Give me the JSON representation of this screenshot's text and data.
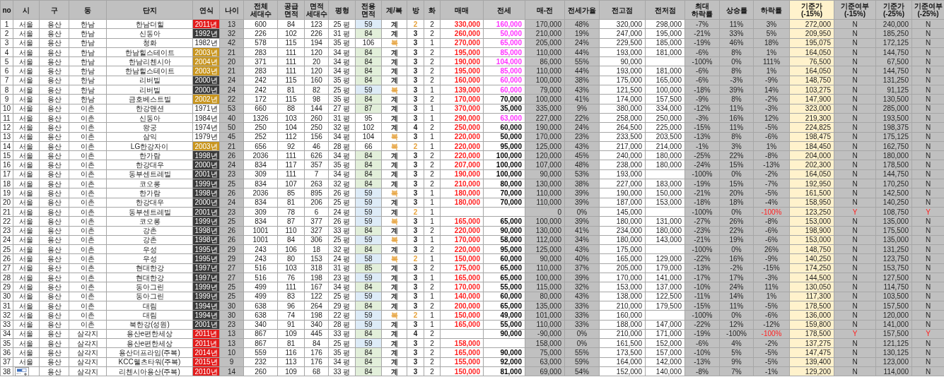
{
  "sheet": {
    "columns": [
      "no",
      "시",
      "구",
      "동",
      "단지",
      "연식",
      "나이",
      "전체 세대수",
      "공급 면적",
      "면적 세대수",
      "평형",
      "전용 면적",
      "계/복",
      "방",
      "화",
      "매매",
      "전세",
      "매-전",
      "전세가율",
      "전고점",
      "전저점",
      "최대 하락률",
      "상승률",
      "하락률",
      "기준가 (-15%)",
      "기준여부 (-15%)",
      "기준가 (-25%)",
      "기준여부 (-25%)"
    ],
    "rows": [
      {
        "cells": [
          "1",
          "서울",
          "용산",
          "한남",
          "한남더힐",
          {
            "text": "2011년",
            "color": "#e31b1b"
          },
          "13",
          "600",
          "84",
          "123",
          "25 평",
          {
            "text": "59",
            "color": "#ddebf7"
          },
          "계",
          {
            "text": "2",
            "color": "#e6a23c"
          },
          "2",
          "330,000",
          {
            "text": "160,000",
            "color": "#ff33ff"
          },
          "170,000",
          "48%",
          "320,000",
          "298,000",
          "-7%",
          "11%",
          "3%",
          "272,000",
          "N",
          "240,000",
          "N"
        ],
        "alert": false
      },
      {
        "cells": [
          "2",
          "서울",
          "용산",
          "한남",
          "신동아",
          {
            "text": "1992년",
            "color": "#3b3b3b"
          },
          "32",
          "226",
          "102",
          "226",
          "31 평",
          {
            "text": "84",
            "color": "#e2efda"
          },
          "계",
          "3",
          "2",
          "260,000",
          {
            "text": "50,000",
            "color": "#ff33ff"
          },
          "210,000",
          "19%",
          "247,000",
          "195,000",
          "-21%",
          "33%",
          "5%",
          "209,950",
          "N",
          "185,250",
          "N"
        ],
        "alert": false
      },
      {
        "cells": [
          "3",
          "서울",
          "용산",
          "한남",
          "청화",
          {
            "text": "1982년",
            "color": "#ffffff"
          },
          "42",
          "578",
          "115",
          "194",
          "35 평",
          {
            "text": "106",
            "color": "#ffffff"
          },
          {
            "text": "복",
            "color": "#e6a23c"
          },
          "3",
          "1",
          "270,000",
          {
            "text": "65,000",
            "color": "#ff33ff"
          },
          "205,000",
          "24%",
          "229,500",
          "185,000",
          "-19%",
          "46%",
          "18%",
          "195,075",
          "N",
          "172,125",
          "N"
        ],
        "alert": false
      },
      {
        "cells": [
          "4",
          "서울",
          "용산",
          "한남",
          "한남힐스테이트",
          {
            "text": "2003년",
            "color": "#c9961f"
          },
          "21",
          "283",
          "111",
          "120",
          "34 평",
          {
            "text": "84",
            "color": "#e2efda"
          },
          "계",
          "3",
          "2",
          "195,000",
          {
            "text": "85,000",
            "color": "#ff33ff"
          },
          "110,000",
          "44%",
          "193,000",
          "181,000",
          "-6%",
          "8%",
          "1%",
          "164,050",
          "N",
          "144,750",
          "N"
        ],
        "alert": false
      },
      {
        "cells": [
          "5",
          "서울",
          "용산",
          "한남",
          "한남리첸시아",
          {
            "text": "2004년",
            "color": "#c9961f"
          },
          "20",
          "371",
          "111",
          "20",
          "34 평",
          {
            "text": "84",
            "color": "#e2efda"
          },
          "계",
          "3",
          "2",
          "190,000",
          {
            "text": "104,000",
            "color": "#ff33ff"
          },
          "86,000",
          "55%",
          "90,000",
          null,
          "-100%",
          "0%",
          "111%",
          "76,500",
          "N",
          "67,500",
          "N"
        ],
        "alert": false
      },
      {
        "cells": [
          "6",
          "서울",
          "용산",
          "한남",
          "한남힐스테이트",
          {
            "text": "2003년",
            "color": "#c9961f"
          },
          "21",
          "283",
          "111",
          "120",
          "34 평",
          {
            "text": "84",
            "color": "#e2efda"
          },
          "계",
          "3",
          "2",
          "195,000",
          {
            "text": "85,000",
            "color": "#ff33ff"
          },
          "110,000",
          "44%",
          "193,000",
          "181,000",
          "-6%",
          "8%",
          "1%",
          "164,050",
          "N",
          "144,750",
          "N"
        ],
        "alert": false
      },
      {
        "cells": [
          "7",
          "서울",
          "용산",
          "한남",
          "리버빌",
          {
            "text": "2000년",
            "color": "#3b3b3b"
          },
          "24",
          "242",
          "115",
          "160",
          "35 평",
          {
            "text": "84",
            "color": "#e2efda"
          },
          "계",
          "3",
          "2",
          "160,000",
          {
            "text": "60,000",
            "color": "#ff33ff"
          },
          "100,000",
          "38%",
          "175,000",
          "165,000",
          "-6%",
          "-3%",
          "-9%",
          "148,750",
          "N",
          "131,250",
          "N"
        ],
        "alert": false
      },
      {
        "cells": [
          "8",
          "서울",
          "용산",
          "한남",
          "리버빌",
          {
            "text": "2000년",
            "color": "#3b3b3b"
          },
          "24",
          "242",
          "81",
          "82",
          "25 평",
          {
            "text": "59",
            "color": "#ddebf7"
          },
          {
            "text": "복",
            "color": "#e6a23c"
          },
          "3",
          "1",
          "139,000",
          {
            "text": "60,000",
            "color": "#ff33ff"
          },
          "79,000",
          "43%",
          "121,500",
          "100,000",
          "-18%",
          "39%",
          "14%",
          "103,275",
          "N",
          "91,125",
          "N"
        ],
        "alert": false
      },
      {
        "cells": [
          "9",
          "서울",
          "용산",
          "한남",
          "금호베스트빌",
          {
            "text": "2002년",
            "color": "#c9961f"
          },
          "22",
          "172",
          "115",
          "98",
          "35 평",
          {
            "text": "84",
            "color": "#e2efda"
          },
          "계",
          "3",
          "2",
          "170,000",
          {
            "text": "70,000",
            "color": "#000000"
          },
          "100,000",
          "41%",
          "174,000",
          "157,500",
          "-9%",
          "8%",
          "-2%",
          "147,900",
          "N",
          "130,500",
          "N"
        ],
        "alert": false
      },
      {
        "cells": [
          "10",
          "서울",
          "용산",
          "이촌",
          "한강맨션",
          {
            "text": "1971년",
            "color": "#ffffff"
          },
          "53",
          "660",
          "88",
          "144",
          "27 평",
          {
            "text": "87",
            "color": "#e2efda"
          },
          "계",
          "3",
          "1",
          "370,000",
          {
            "text": "35,000",
            "color": "#000000"
          },
          "335,000",
          "9%",
          "380,000",
          "334,000",
          "-12%",
          "11%",
          "-3%",
          "323,000",
          "N",
          "285,000",
          "N"
        ],
        "alert": false
      },
      {
        "cells": [
          "11",
          "서울",
          "용산",
          "이촌",
          "신동아",
          {
            "text": "1984년",
            "color": "#ffffff"
          },
          "40",
          "1326",
          "103",
          "260",
          "31 평",
          {
            "text": "95",
            "color": "#ffffff"
          },
          "계",
          "3",
          "1",
          "290,000",
          {
            "text": "63,000",
            "color": "#ff33ff"
          },
          "227,000",
          "22%",
          "258,000",
          "250,000",
          "-3%",
          "16%",
          "12%",
          "219,300",
          "N",
          "193,500",
          "N"
        ],
        "alert": false
      },
      {
        "cells": [
          "12",
          "서울",
          "용산",
          "이촌",
          "왕궁",
          {
            "text": "1974년",
            "color": "#ffffff"
          },
          "50",
          "250",
          "104",
          "250",
          "32 평",
          {
            "text": "102",
            "color": "#ffffff"
          },
          "계",
          "4",
          "2",
          "250,000",
          {
            "text": "60,000",
            "color": "#000000"
          },
          "190,000",
          "24%",
          "264,500",
          "225,000",
          "-15%",
          "11%",
          "-5%",
          "224,825",
          "N",
          "198,375",
          "N"
        ],
        "alert": false
      },
      {
        "cells": [
          "13",
          "서울",
          "용산",
          "이촌",
          "삼익",
          {
            "text": "1979년",
            "color": "#ffffff"
          },
          "45",
          "252",
          "112",
          "156",
          "34 평",
          {
            "text": "104",
            "color": "#ffffff"
          },
          {
            "text": "복",
            "color": "#e6a23c"
          },
          "3",
          "1",
          "220,000",
          {
            "text": "50,000",
            "color": "#000000"
          },
          "170,000",
          "23%",
          "233,500",
          "203,500",
          "-13%",
          "8%",
          "-6%",
          "198,475",
          "N",
          "175,125",
          "N"
        ],
        "alert": false
      },
      {
        "cells": [
          "14",
          "서울",
          "용산",
          "이촌",
          "LG한강자이",
          {
            "text": "2003년",
            "color": "#c9961f"
          },
          "21",
          "656",
          "92",
          "46",
          "28 평",
          {
            "text": "66",
            "color": "#ffffff"
          },
          {
            "text": "복",
            "color": "#e6a23c"
          },
          {
            "text": "2",
            "color": "#e6a23c"
          },
          "1",
          "220,000",
          {
            "text": "95,000",
            "color": "#000000"
          },
          "125,000",
          "43%",
          "217,000",
          "214,000",
          "-1%",
          "3%",
          "1%",
          "184,450",
          "N",
          "162,750",
          "N"
        ],
        "alert": false
      },
      {
        "cells": [
          "15",
          "서울",
          "용산",
          "이촌",
          "한가람",
          {
            "text": "1998년",
            "color": "#3b3b3b"
          },
          "26",
          "2036",
          "111",
          "626",
          "34 평",
          {
            "text": "84",
            "color": "#e2efda"
          },
          "계",
          "3",
          "2",
          "220,000",
          {
            "text": "100,000",
            "color": "#000000"
          },
          "120,000",
          "45%",
          "240,000",
          "180,000",
          "-25%",
          "22%",
          "-8%",
          "204,000",
          "N",
          "180,000",
          "N"
        ],
        "alert": false
      },
      {
        "cells": [
          "16",
          "서울",
          "용산",
          "이촌",
          "한강대우",
          {
            "text": "2000년",
            "color": "#3b3b3b"
          },
          "24",
          "834",
          "117",
          "357",
          "35 평",
          {
            "text": "84",
            "color": "#e2efda"
          },
          "계",
          "3",
          "2",
          "207,000",
          {
            "text": "100,000",
            "color": "#000000"
          },
          "107,000",
          "48%",
          "238,000",
          "180,000",
          "-24%",
          "15%",
          "-13%",
          "202,300",
          "N",
          "178,500",
          "N"
        ],
        "alert": false
      },
      {
        "cells": [
          "17",
          "서울",
          "용산",
          "이촌",
          "동부센트레빌",
          {
            "text": "2001년",
            "color": "#3b3b3b"
          },
          "23",
          "309",
          "111",
          "7",
          "34 평",
          {
            "text": "84",
            "color": "#e2efda"
          },
          "계",
          "3",
          "2",
          "190,000",
          {
            "text": "100,000",
            "color": "#000000"
          },
          "90,000",
          "53%",
          "193,000",
          null,
          "-100%",
          "0%",
          "-2%",
          "164,050",
          "N",
          "144,750",
          "N"
        ],
        "alert": false
      },
      {
        "cells": [
          "18",
          "서울",
          "용산",
          "이촌",
          "코오롱",
          {
            "text": "1999년",
            "color": "#3b3b3b"
          },
          "25",
          "834",
          "107",
          "263",
          "32 평",
          {
            "text": "84",
            "color": "#e2efda"
          },
          "계",
          "3",
          "2",
          "210,000",
          {
            "text": "80,000",
            "color": "#000000"
          },
          "130,000",
          "38%",
          "227,000",
          "183,000",
          "-19%",
          "15%",
          "-7%",
          "192,950",
          "N",
          "170,250",
          "N"
        ],
        "alert": false
      },
      {
        "cells": [
          "19",
          "서울",
          "용산",
          "이촌",
          "한가람",
          {
            "text": "1998년",
            "color": "#3b3b3b"
          },
          "26",
          "2036",
          "85",
          "895",
          "26 평",
          {
            "text": "59",
            "color": "#ddebf7"
          },
          {
            "text": "복",
            "color": "#e6a23c"
          },
          "3",
          "1",
          "180,000",
          {
            "text": "70,000",
            "color": "#000000"
          },
          "110,000",
          "39%",
          "190,000",
          "150,000",
          "-21%",
          "20%",
          "-5%",
          "161,500",
          "N",
          "142,500",
          "N"
        ],
        "alert": false
      },
      {
        "cells": [
          "20",
          "서울",
          "용산",
          "이촌",
          "한강대우",
          {
            "text": "2000년",
            "color": "#3b3b3b"
          },
          "24",
          "834",
          "81",
          "206",
          "25 평",
          {
            "text": "59",
            "color": "#ddebf7"
          },
          "계",
          "3",
          "1",
          "180,000",
          {
            "text": "70,000",
            "color": "#000000"
          },
          "110,000",
          "39%",
          "187,000",
          "153,000",
          "-18%",
          "18%",
          "-4%",
          "158,950",
          "N",
          "140,250",
          "N"
        ],
        "alert": false
      },
      {
        "cells": [
          "21",
          "서울",
          "용산",
          "이촌",
          "동부센트레빌",
          {
            "text": "2001년",
            "color": "#3b3b3b"
          },
          "23",
          "309",
          "78",
          "6",
          "24 평",
          {
            "text": "59",
            "color": "#ddebf7"
          },
          "계",
          {
            "text": "2",
            "color": "#e6a23c"
          },
          "1",
          null,
          null,
          "0",
          "0%",
          "145,000",
          null,
          "-100%",
          "0%",
          "-100%",
          "123,250",
          "Y",
          "108,750",
          "Y"
        ],
        "alert": true
      },
      {
        "cells": [
          "22",
          "서울",
          "용산",
          "이촌",
          "코오롱",
          {
            "text": "1999년",
            "color": "#3b3b3b"
          },
          "25",
          "834",
          "87",
          "377",
          "26 평",
          {
            "text": "59",
            "color": "#ddebf7"
          },
          {
            "text": "복",
            "color": "#e6a23c"
          },
          "3",
          "1",
          "165,000",
          {
            "text": "65,000",
            "color": "#000000"
          },
          "100,000",
          "39%",
          "180,000",
          "131,000",
          "-27%",
          "26%",
          "-8%",
          "153,000",
          "N",
          "135,000",
          "N"
        ],
        "alert": false
      },
      {
        "cells": [
          "23",
          "서울",
          "용산",
          "이촌",
          "강촌",
          {
            "text": "1998년",
            "color": "#3b3b3b"
          },
          "26",
          "1001",
          "110",
          "327",
          "33 평",
          {
            "text": "84",
            "color": "#e2efda"
          },
          "계",
          "3",
          "2",
          "220,000",
          {
            "text": "90,000",
            "color": "#000000"
          },
          "130,000",
          "41%",
          "234,000",
          "180,000",
          "-23%",
          "22%",
          "-6%",
          "198,900",
          "N",
          "175,500",
          "N"
        ],
        "alert": false
      },
      {
        "cells": [
          "24",
          "서울",
          "용산",
          "이촌",
          "강촌",
          {
            "text": "1998년",
            "color": "#3b3b3b"
          },
          "26",
          "1001",
          "84",
          "306",
          "25 평",
          {
            "text": "59",
            "color": "#ddebf7"
          },
          {
            "text": "복",
            "color": "#e6a23c"
          },
          "3",
          "1",
          "170,000",
          {
            "text": "58,000",
            "color": "#000000"
          },
          "112,000",
          "34%",
          "180,000",
          "143,000",
          "-21%",
          "19%",
          "-6%",
          "153,000",
          "N",
          "135,000",
          "N"
        ],
        "alert": false
      },
      {
        "cells": [
          "25",
          "서울",
          "용산",
          "이촌",
          "우성",
          {
            "text": "1995년",
            "color": "#3b3b3b"
          },
          "29",
          "243",
          "106",
          "18",
          "32 평",
          {
            "text": "84",
            "color": "#e2efda"
          },
          "계",
          "3",
          "2",
          "220,000",
          {
            "text": "95,000",
            "color": "#000000"
          },
          "125,000",
          "43%",
          "175,000",
          null,
          "-100%",
          "0%",
          "26%",
          "148,750",
          "N",
          "131,250",
          "N"
        ],
        "alert": false
      },
      {
        "cells": [
          "26",
          "서울",
          "용산",
          "이촌",
          "우성",
          {
            "text": "1995년",
            "color": "#3b3b3b"
          },
          "29",
          "243",
          "80",
          "153",
          "24 평",
          {
            "text": "58",
            "color": "#ddebf7"
          },
          {
            "text": "복",
            "color": "#e6a23c"
          },
          {
            "text": "2",
            "color": "#e6a23c"
          },
          "1",
          "150,000",
          {
            "text": "60,000",
            "color": "#000000"
          },
          "90,000",
          "40%",
          "165,000",
          "129,000",
          "-22%",
          "16%",
          "-9%",
          "140,250",
          "N",
          "123,750",
          "N"
        ],
        "alert": false
      },
      {
        "cells": [
          "27",
          "서울",
          "용산",
          "이촌",
          "현대한강",
          {
            "text": "1997년",
            "color": "#3b3b3b"
          },
          "27",
          "516",
          "103",
          "318",
          "31 평",
          {
            "text": "85",
            "color": "#e2efda"
          },
          "계",
          "3",
          "2",
          "175,000",
          {
            "text": "65,000",
            "color": "#000000"
          },
          "110,000",
          "37%",
          "205,000",
          "179,000",
          "-13%",
          "-2%",
          "-15%",
          "174,250",
          "N",
          "153,750",
          "N"
        ],
        "alert": false
      },
      {
        "cells": [
          "28",
          "서울",
          "용산",
          "이촌",
          "현대한강",
          {
            "text": "1997년",
            "color": "#3b3b3b"
          },
          "27",
          "516",
          "76",
          "198",
          "23 평",
          {
            "text": "59",
            "color": "#ddebf7"
          },
          "계",
          "3",
          "1",
          "165,000",
          {
            "text": "65,000",
            "color": "#000000"
          },
          "100,000",
          "39%",
          "170,000",
          "141,000",
          "-17%",
          "17%",
          "-3%",
          "144,500",
          "N",
          "127,500",
          "N"
        ],
        "alert": false
      },
      {
        "cells": [
          "29",
          "서울",
          "용산",
          "이촌",
          "동아그린",
          {
            "text": "1999년",
            "color": "#3b3b3b"
          },
          "25",
          "499",
          "111",
          "167",
          "34 평",
          {
            "text": "84",
            "color": "#e2efda"
          },
          "계",
          "3",
          "2",
          "170,000",
          {
            "text": "55,000",
            "color": "#000000"
          },
          "115,000",
          "32%",
          "153,000",
          "137,000",
          "-10%",
          "24%",
          "11%",
          "130,050",
          "N",
          "114,750",
          "N"
        ],
        "alert": false
      },
      {
        "cells": [
          "30",
          "서울",
          "용산",
          "이촌",
          "동아그린",
          {
            "text": "1999년",
            "color": "#3b3b3b"
          },
          "25",
          "499",
          "83",
          "122",
          "25 평",
          {
            "text": "59",
            "color": "#ddebf7"
          },
          "계",
          "3",
          "1",
          "140,000",
          {
            "text": "60,000",
            "color": "#000000"
          },
          "80,000",
          "43%",
          "138,000",
          "122,500",
          "-11%",
          "14%",
          "1%",
          "117,300",
          "N",
          "103,500",
          "N"
        ],
        "alert": false
      },
      {
        "cells": [
          "31",
          "서울",
          "용산",
          "이촌",
          "대림",
          {
            "text": "1994년",
            "color": "#3b3b3b"
          },
          "30",
          "638",
          "96",
          "264",
          "29 평",
          {
            "text": "84",
            "color": "#e2efda"
          },
          "계",
          "3",
          "2",
          "200,000",
          {
            "text": "65,000",
            "color": "#000000"
          },
          "135,000",
          "33%",
          "210,000",
          "179,500",
          "-15%",
          "11%",
          "-5%",
          "178,500",
          "N",
          "157,500",
          "N"
        ],
        "alert": false
      },
      {
        "cells": [
          "32",
          "서울",
          "용산",
          "이촌",
          "대림",
          {
            "text": "1994년",
            "color": "#3b3b3b"
          },
          "30",
          "638",
          "74",
          "198",
          "22 평",
          {
            "text": "59",
            "color": "#ddebf7"
          },
          {
            "text": "복",
            "color": "#e6a23c"
          },
          {
            "text": "2",
            "color": "#e6a23c"
          },
          "1",
          "150,000",
          {
            "text": "49,000",
            "color": "#000000"
          },
          "101,000",
          "33%",
          "160,000",
          null,
          "-100%",
          "0%",
          "-6%",
          "136,000",
          "N",
          "120,000",
          "N"
        ],
        "alert": false
      },
      {
        "cells": [
          "33",
          "서울",
          "용산",
          "이촌",
          "북한강(성원)",
          {
            "text": "2001년",
            "color": "#3b3b3b"
          },
          "23",
          "340",
          "91",
          "340",
          "28 평",
          {
            "text": "59",
            "color": "#ddebf7"
          },
          "계",
          "3",
          "1",
          "165,000",
          {
            "text": "55,000",
            "color": "#000000"
          },
          "110,000",
          "33%",
          "188,000",
          "147,000",
          "-22%",
          "12%",
          "-12%",
          "159,800",
          "N",
          "141,000",
          "N"
        ],
        "alert": false
      },
      {
        "cells": [
          "34",
          "서울",
          "용산",
          "삼각지",
          "용산e편한세상",
          {
            "text": "2011년",
            "color": "#e31b1b"
          },
          "13",
          "867",
          "109",
          "445",
          "33 평",
          {
            "text": "84",
            "color": "#e2efda"
          },
          "계",
          "4",
          "2",
          null,
          {
            "text": "90,000",
            "color": "#000000"
          },
          "-90,000",
          "0%",
          "210,000",
          "171,000",
          "-19%",
          "-100%",
          "-100%",
          "178,500",
          "Y",
          "157,500",
          "Y"
        ],
        "alert": true
      },
      {
        "cells": [
          "35",
          "서울",
          "용산",
          "삼각지",
          "용산e편한세상",
          {
            "text": "2011년",
            "color": "#e31b1b"
          },
          "13",
          "867",
          "81",
          "84",
          "25 평",
          {
            "text": "59",
            "color": "#ddebf7"
          },
          "계",
          "3",
          "2",
          "158,000",
          null,
          "158,000",
          "0%",
          "161,500",
          "152,000",
          "-6%",
          "4%",
          "-2%",
          "137,275",
          "N",
          "121,125",
          "N"
        ],
        "alert": false
      },
      {
        "cells": [
          "36",
          "서울",
          "용산",
          "삼각지",
          "용산더프라임(주복)",
          {
            "text": "2014년",
            "color": "#e31b1b"
          },
          "10",
          "559",
          "116",
          "176",
          "35 평",
          {
            "text": "84",
            "color": "#e2efda"
          },
          "계",
          "3",
          "2",
          "165,000",
          {
            "text": "90,000",
            "color": "#000000"
          },
          "75,000",
          "55%",
          "173,500",
          "157,000",
          "-10%",
          "5%",
          "-5%",
          "147,475",
          "N",
          "130,125",
          "N"
        ],
        "alert": false
      },
      {
        "cells": [
          "37",
          "서울",
          "용산",
          "삼각지",
          "KCC웰츠타워(주복)",
          {
            "text": "2015년",
            "color": "#e31b1b"
          },
          "9",
          "232",
          "113",
          "176",
          "34 평",
          {
            "text": "84",
            "color": "#e2efda"
          },
          "계",
          "3",
          "2",
          "155,000",
          {
            "text": "92,000",
            "color": "#000000"
          },
          "63,000",
          "59%",
          "164,000",
          "142,000",
          "-13%",
          "9%",
          "-5%",
          "139,400",
          "N",
          "123,000",
          "N"
        ],
        "alert": false
      },
      {
        "cells": [
          "38",
          null,
          "용산",
          "삼각지",
          "리첸시아용산(주복)",
          {
            "text": "2010년",
            "color": "#e31b1b"
          },
          "14",
          "260",
          "109",
          "68",
          "33 평",
          {
            "text": "84",
            "color": "#e2efda"
          },
          "계",
          "3",
          "2",
          "150,000",
          {
            "text": "81,000",
            "color": "#000000"
          },
          "69,000",
          "54%",
          "152,000",
          "140,000",
          "-8%",
          "7%",
          "-1%",
          "129,200",
          "N",
          "114,000",
          "N"
        ],
        "alert": false
      }
    ]
  }
}
